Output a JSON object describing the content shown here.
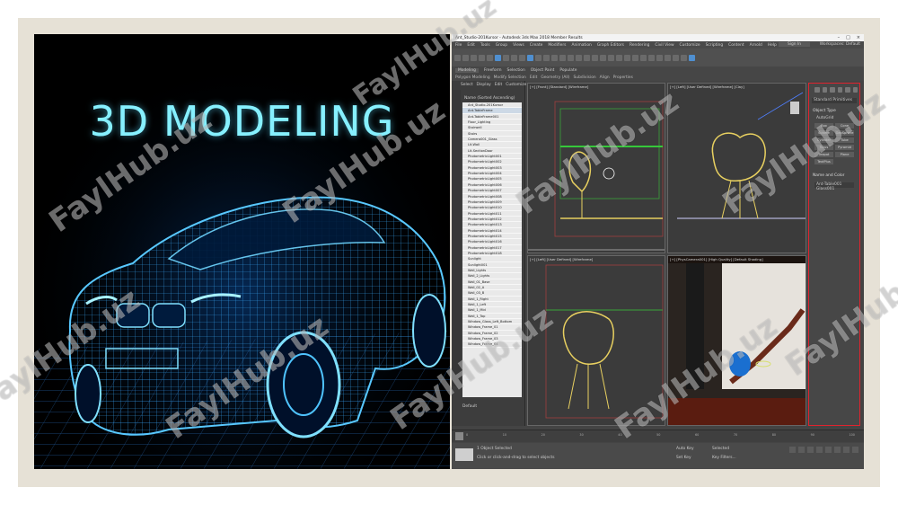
{
  "poster": {
    "title": "3D MODELING"
  },
  "app": {
    "window_title": "Ant_Studio-201Kursor - Autodesk 3ds Max 2018 Member Results",
    "window_controls": [
      "–",
      "□",
      "×"
    ],
    "menu": [
      "File",
      "Edit",
      "Tools",
      "Group",
      "Views",
      "Create",
      "Modifiers",
      "Animation",
      "Graph Editors",
      "Rendering",
      "Civil View",
      "Customize",
      "Scripting",
      "Content",
      "Arnold",
      "Help"
    ],
    "sign_in": "Sign In",
    "workspace": "Workspaces: Default",
    "ribbon_tabs": [
      "Modeling",
      "Freeform",
      "Selection",
      "Object Paint",
      "Populate"
    ],
    "ribbon_sub": [
      "Polygon Modeling",
      "Modify Selection",
      "Edit",
      "Geometry (All)",
      "Subdivision",
      "Align",
      "Properties"
    ],
    "scene_tabs": [
      "Select",
      "Display",
      "Edit",
      "Customize"
    ],
    "scene_header": "Name (Sorted Ascending)",
    "scene_rows": [
      "Ant_Studio-201Kursor",
      "Ant-TableFrame",
      "Ant-TableFrame001",
      "Floor_Lighting",
      "Stairwell",
      "Stairs",
      "Camera001_Glass",
      "Lit-Wall",
      "Lit-SectionDoor",
      "PhotometricLight001",
      "PhotometricLight002",
      "PhotometricLight003",
      "PhotometricLight004",
      "PhotometricLight005",
      "PhotometricLight006",
      "PhotometricLight007",
      "PhotometricLight008",
      "PhotometricLight009",
      "PhotometricLight010",
      "PhotometricLight011",
      "PhotometricLight012",
      "PhotometricLight013",
      "PhotometricLight014",
      "PhotometricLight015",
      "PhotometricLight016",
      "PhotometricLight017",
      "PhotometricLight018",
      "Sunlight",
      "Sunlight001",
      "Wall_Lights",
      "Wall_2_Lights",
      "Wall_01_Base",
      "Wall_02_A",
      "Wall_03_B",
      "Wall_1_Right",
      "Wall_1_Left",
      "Wall_1_Mid",
      "Wall_1_Top",
      "Window_Glass_Left_Bottom",
      "Window_Frame_01",
      "Window_Frame_02",
      "Window_Frame_03",
      "Window_Frame_04"
    ],
    "scene_selected_index": 1,
    "scene_footer": "Default",
    "viewports": [
      {
        "label": "[+] [Front] [Standard] [Wireframe]"
      },
      {
        "label": "[+] [Left] [User Defined] [Wireframe] [Clay]"
      },
      {
        "label": "[+] [Left] [User Defined] [Wireframe]"
      },
      {
        "label": "[+] [PhysCamera001] [High Quality] [Default Shading]"
      }
    ],
    "command_panel": {
      "dropdown": "Standard Primitives",
      "object_type_title": "Object Type",
      "autogrid": "AutoGrid",
      "buttons": [
        "Box",
        "Cone",
        "Sphere",
        "GeoSphere",
        "Cylinder",
        "Tube",
        "Torus",
        "Pyramid",
        "Teapot",
        "Plane",
        "TextPlus"
      ],
      "name_color_title": "Name and Color",
      "name_field": "Ant-Table001 Glass001"
    },
    "timeline_ticks": [
      "0",
      "10",
      "20",
      "30",
      "40",
      "50",
      "60",
      "70",
      "80",
      "90",
      "100"
    ],
    "timeline_position": "0 / 100",
    "status_line1": "1 Object Selected",
    "status_line2": "Click or click-and-drag to select objects",
    "autokey": "Auto Key",
    "selected": "Selected",
    "set_key": "Set Key",
    "key_filters": "Key Filters..."
  },
  "watermarks": [
    "FaylHub.uz",
    "FaylHub.uz",
    "FaylHub.uz",
    "FaylHub.uz",
    "FaylHub.uz",
    "FaylHub.uz",
    "FaylHub.uz",
    "FaylHub.uz",
    "FaylHub.uz",
    "FaylHub.uz"
  ],
  "colors": {
    "accent_cyan": "#86f0ff",
    "wire_blue": "#2fa8ff",
    "viewport_bg": "#3c3c3c",
    "chair_yellow": "#e8d060",
    "command_panel_border": "#e0232e"
  }
}
